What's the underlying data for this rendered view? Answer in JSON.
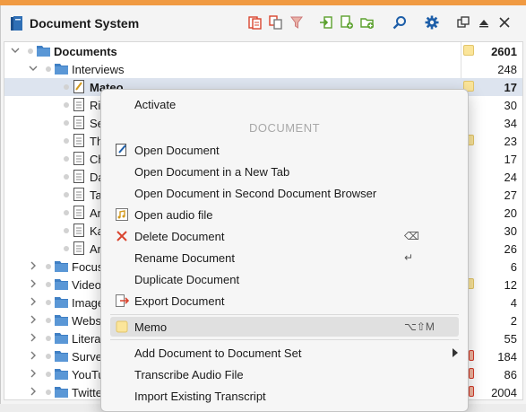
{
  "app": {
    "title": "Document System",
    "accent_color": "#f09a42",
    "toolbar": [
      "document-stack-icon",
      "copy-icon",
      "filter-icon",
      "import-icon",
      "add-document-icon",
      "new-folder-icon",
      "search-icon",
      "gear-icon",
      "undock-icon",
      "collapse-icon",
      "close-icon"
    ]
  },
  "tree": {
    "root": {
      "label": "Documents",
      "count": "2601"
    },
    "group": {
      "label": "Interviews",
      "count": "248"
    },
    "docs": [
      {
        "label": "Mateo",
        "count": "17",
        "selected": true
      },
      {
        "label": "Ril",
        "count": "30"
      },
      {
        "label": "Se",
        "count": "34"
      },
      {
        "label": "Th",
        "count": "23"
      },
      {
        "label": "Ch",
        "count": "17"
      },
      {
        "label": "Da",
        "count": "24"
      },
      {
        "label": "Ta",
        "count": "27"
      },
      {
        "label": "An",
        "count": "20"
      },
      {
        "label": "Ka",
        "count": "30"
      },
      {
        "label": "Ar",
        "count": "26"
      }
    ],
    "folders": [
      {
        "label": "Focus",
        "count": "6"
      },
      {
        "label": "Video",
        "count": "12"
      },
      {
        "label": "Image",
        "count": "4"
      },
      {
        "label": "Webs",
        "count": "2"
      },
      {
        "label": "Litera",
        "count": "55"
      },
      {
        "label": "Surve",
        "count": "184"
      },
      {
        "label": "YouTu",
        "count": "86"
      },
      {
        "label": "Twitte",
        "count": "2004"
      }
    ]
  },
  "context_menu": {
    "activate": "Activate",
    "section_header": "DOCUMENT",
    "open_document": "Open Document",
    "open_new_tab": "Open Document in a New Tab",
    "open_second_browser": "Open Document in Second Document Browser",
    "open_audio": "Open audio file",
    "delete_document": "Delete Document",
    "delete_shortcut": "⌫",
    "rename_document": "Rename Document",
    "rename_shortcut": "↵",
    "duplicate_document": "Duplicate Document",
    "export_document": "Export Document",
    "memo": "Memo",
    "memo_shortcut": "⌥⇧M",
    "add_to_set": "Add Document to Document Set",
    "transcribe": "Transcribe Audio File",
    "import_transcript": "Import Existing Transcript"
  }
}
